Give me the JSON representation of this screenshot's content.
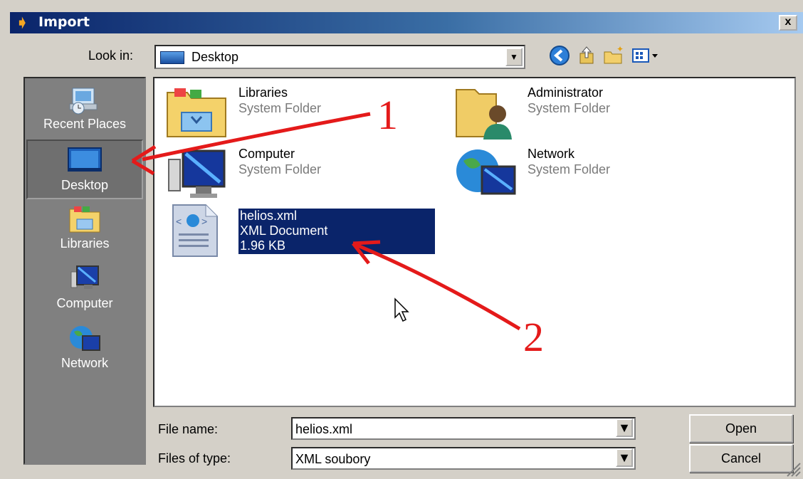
{
  "window": {
    "title": "Import",
    "close_label": "x"
  },
  "lookin": {
    "label": "Look in:",
    "value": "Desktop"
  },
  "toolbar": {
    "icons": [
      "back-icon",
      "up-folder-icon",
      "new-folder-icon",
      "view-menu-icon"
    ]
  },
  "places": [
    {
      "label": "Recent Places",
      "icon": "recent-places-icon"
    },
    {
      "label": "Desktop",
      "icon": "desktop-icon",
      "selected": true
    },
    {
      "label": "Libraries",
      "icon": "libraries-icon"
    },
    {
      "label": "Computer",
      "icon": "computer-icon"
    },
    {
      "label": "Network",
      "icon": "network-icon"
    }
  ],
  "files": [
    {
      "name": "Libraries",
      "type": "System Folder",
      "icon": "libraries-folder-icon"
    },
    {
      "name": "Administrator",
      "type": "System Folder",
      "icon": "user-folder-icon"
    },
    {
      "name": "Computer",
      "type": "System Folder",
      "icon": "computer-icon"
    },
    {
      "name": "Network",
      "type": "System Folder",
      "icon": "network-icon"
    },
    {
      "name": "helios.xml",
      "type": "XML Document",
      "size": "1.96 KB",
      "icon": "xml-document-icon",
      "selected": true
    }
  ],
  "filename": {
    "label": "File name:",
    "value": "helios.xml"
  },
  "filetype": {
    "label": "Files of type:",
    "value": "XML soubory"
  },
  "buttons": {
    "open": "Open",
    "cancel": "Cancel"
  },
  "annotations": {
    "one": "1",
    "two": "2",
    "arrow_color": "#e41a1a"
  },
  "colors": {
    "selection": "#0a246a",
    "title_gradient_start": "#0a246a",
    "dialog_face": "#d4d0c8",
    "places_bar": "#808080"
  }
}
